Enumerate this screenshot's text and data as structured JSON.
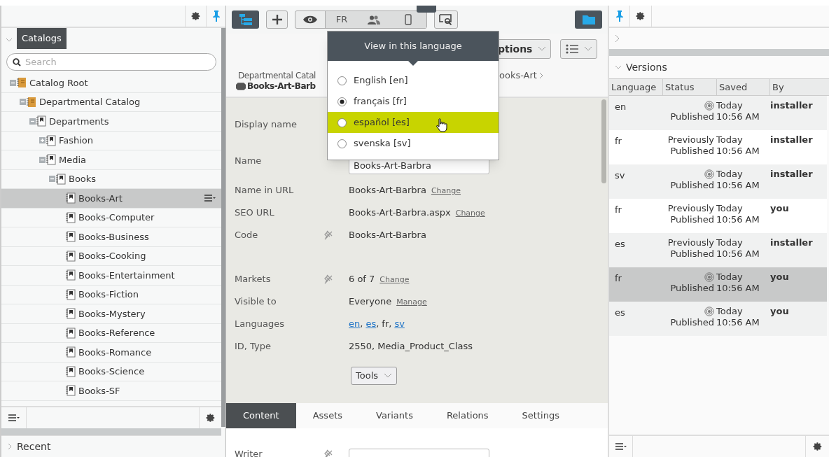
{
  "left_panel": {
    "tab": "Catalogs",
    "search": {
      "placeholder": "Search"
    },
    "tree": [
      {
        "label": "Catalog Root",
        "kind": "catalog",
        "expanded": true,
        "selected": false,
        "children": [
          {
            "label": "Departmental Catalog",
            "kind": "catalog",
            "expanded": true,
            "selected": false,
            "children": [
              {
                "label": "Departments",
                "kind": "node",
                "expanded": true,
                "selected": false,
                "children": [
                  {
                    "label": "Fashion",
                    "kind": "node",
                    "expanded": false,
                    "selected": false
                  },
                  {
                    "label": "Media",
                    "kind": "node",
                    "expanded": true,
                    "selected": false,
                    "children": [
                      {
                        "label": "Books",
                        "kind": "node",
                        "expanded": true,
                        "selected": false,
                        "children": [
                          {
                            "label": "Books-Art",
                            "kind": "node",
                            "selected": true
                          },
                          {
                            "label": "Books-Computer",
                            "kind": "node",
                            "selected": false
                          },
                          {
                            "label": "Books-Business",
                            "kind": "node",
                            "selected": false
                          },
                          {
                            "label": "Books-Cooking",
                            "kind": "node",
                            "selected": false
                          },
                          {
                            "label": "Books-Entertainment",
                            "kind": "node",
                            "selected": false
                          },
                          {
                            "label": "Books-Fiction",
                            "kind": "node",
                            "selected": false
                          },
                          {
                            "label": "Books-Mystery",
                            "kind": "node",
                            "selected": false
                          },
                          {
                            "label": "Books-Reference",
                            "kind": "node",
                            "selected": false
                          },
                          {
                            "label": "Books-Romance",
                            "kind": "node",
                            "selected": false
                          },
                          {
                            "label": "Books-Science",
                            "kind": "node",
                            "selected": false
                          },
                          {
                            "label": "Books-SF",
                            "kind": "node",
                            "selected": false
                          }
                        ]
                      }
                    ]
                  }
                ]
              }
            ]
          }
        ]
      }
    ],
    "recent": "Recent"
  },
  "toolbar": {
    "language": "FR"
  },
  "language_menu": {
    "title": "View in this language",
    "options": [
      {
        "label": "English [en]",
        "selected": false,
        "hover": false
      },
      {
        "label": "français [fr]",
        "selected": true,
        "hover": false
      },
      {
        "label": "español [es]",
        "selected": false,
        "hover": true
      },
      {
        "label": "svenska [sv]",
        "selected": false,
        "hover": false
      }
    ]
  },
  "header": {
    "options_button": "ptions",
    "breadcrumb_start": "Departmental Catal",
    "breadcrumb_end": "ooks-Art",
    "title": "Books-Art-Barb"
  },
  "form": [
    {
      "label": "Display name",
      "kind": "text",
      "pin_marker": false
    },
    {
      "label": "Name",
      "kind": "input",
      "value": "Books-Art-Barbra",
      "pin_marker": false
    },
    {
      "label": "Name in URL",
      "kind": "text",
      "value": "Books-Art-Barbra",
      "link": "Change",
      "pin_marker": false
    },
    {
      "label": "SEO URL",
      "kind": "text",
      "value": "Books-Art-Barbra.aspx",
      "link": "Change",
      "pin_marker": false
    },
    {
      "label": "Code",
      "kind": "text",
      "value": "Books-Art-Barbra",
      "pin_marker": true
    },
    {
      "label": "Markets",
      "kind": "text",
      "value": "6 of 7",
      "link": "Change",
      "pin_marker": true
    },
    {
      "label": "Visible to",
      "kind": "text",
      "value": "Everyone",
      "link": "Manage",
      "pin_marker": false
    },
    {
      "label": "Languages",
      "kind": "languages",
      "separator": ",",
      "parts": [
        {
          "text": "en",
          "link": true
        },
        {
          "text": "es",
          "link": true
        },
        {
          "text": "fr",
          "link": false
        },
        {
          "text": "sv",
          "link": true
        }
      ],
      "pin_marker": false
    },
    {
      "label": "ID, Type",
      "kind": "text",
      "value": "2550, Media_Product_Class",
      "pin_marker": false
    },
    {
      "kind": "button",
      "value": "Tools"
    }
  ],
  "tabs": [
    {
      "label": "Content",
      "selected": true
    },
    {
      "label": "Assets",
      "selected": false
    },
    {
      "label": "Variants",
      "selected": false
    },
    {
      "label": "Relations",
      "selected": false
    },
    {
      "label": "Settings",
      "selected": false
    }
  ],
  "content_form": [
    {
      "label": "Writer",
      "pin_marker": true
    }
  ],
  "versions": {
    "title": "Versions",
    "columns": [
      "Language",
      "Status",
      "Saved",
      "By"
    ],
    "rows": [
      {
        "language": "en",
        "status": "Published",
        "kind": "published",
        "saved": "Today",
        "time": "10:56 AM",
        "by": "installer",
        "selected": false
      },
      {
        "language": "fr",
        "status": "Previously Published",
        "kind": "previous",
        "saved": "Today",
        "time": "10:56 AM",
        "by": "installer",
        "selected": false
      },
      {
        "language": "sv",
        "status": "Published",
        "kind": "published",
        "saved": "Today",
        "time": "10:56 AM",
        "by": "installer",
        "selected": false
      },
      {
        "language": "fr",
        "status": "Previously Published",
        "kind": "previous",
        "saved": "Today",
        "time": "10:56 AM",
        "by": "you",
        "selected": false
      },
      {
        "language": "es",
        "status": "Previously Published",
        "kind": "previous",
        "saved": "Today",
        "time": "10:56 AM",
        "by": "installer",
        "selected": false
      },
      {
        "language": "fr",
        "status": "Published",
        "kind": "published",
        "saved": "Today",
        "time": "10:56 AM",
        "by": "you",
        "selected": true
      },
      {
        "language": "es",
        "status": "Published",
        "kind": "published",
        "saved": "Today",
        "time": "10:56 AM",
        "by": "you",
        "selected": false
      }
    ]
  }
}
